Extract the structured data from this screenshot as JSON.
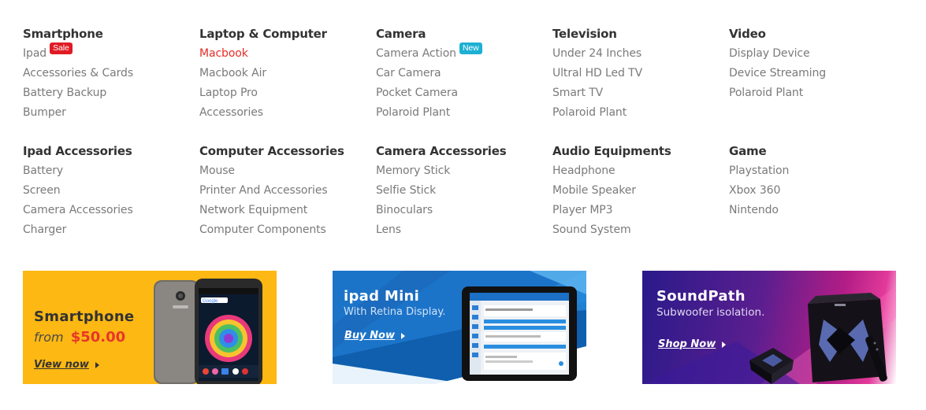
{
  "menu": {
    "row1": [
      {
        "title": "Smartphone",
        "items": [
          {
            "label": "Ipad",
            "badge": "Sale"
          },
          {
            "label": "Accessories & Cards"
          },
          {
            "label": "Battery Backup"
          },
          {
            "label": "Bumper"
          }
        ]
      },
      {
        "title": "Laptop & Computer",
        "items": [
          {
            "label": "Macbook",
            "active": true
          },
          {
            "label": "Macbook Air"
          },
          {
            "label": "Laptop Pro"
          },
          {
            "label": "Accessories"
          }
        ]
      },
      {
        "title": "Camera",
        "items": [
          {
            "label": "Camera Action",
            "badge": "New"
          },
          {
            "label": "Car Camera"
          },
          {
            "label": "Pocket Camera"
          },
          {
            "label": "Polaroid Plant"
          }
        ]
      },
      {
        "title": "Television",
        "items": [
          {
            "label": "Under 24 Inches"
          },
          {
            "label": "Ultral HD Led TV"
          },
          {
            "label": "Smart TV"
          },
          {
            "label": "Polaroid Plant"
          }
        ]
      },
      {
        "title": "Video",
        "items": [
          {
            "label": "Display Device"
          },
          {
            "label": "Device Streaming"
          },
          {
            "label": "Polaroid Plant"
          }
        ]
      }
    ],
    "row2": [
      {
        "title": "Ipad Accessories",
        "items": [
          {
            "label": "Battery"
          },
          {
            "label": "Screen"
          },
          {
            "label": "Camera Accessories"
          },
          {
            "label": "Charger"
          }
        ]
      },
      {
        "title": "Computer Accessories",
        "items": [
          {
            "label": "Mouse"
          },
          {
            "label": "Printer And Accessories"
          },
          {
            "label": "Network Equipment"
          },
          {
            "label": "Computer Components"
          }
        ]
      },
      {
        "title": "Camera Accessories",
        "items": [
          {
            "label": "Memory Stick"
          },
          {
            "label": "Selfie Stick"
          },
          {
            "label": "Binoculars"
          },
          {
            "label": "Lens"
          }
        ]
      },
      {
        "title": "Audio Equipments",
        "items": [
          {
            "label": "Headphone"
          },
          {
            "label": "Mobile Speaker"
          },
          {
            "label": "Player MP3"
          },
          {
            "label": "Sound System"
          }
        ]
      },
      {
        "title": "Game",
        "items": [
          {
            "label": "Playstation"
          },
          {
            "label": "Xbox 360"
          },
          {
            "label": "Nintendo"
          }
        ]
      }
    ]
  },
  "banners": {
    "smartphone": {
      "title": "Smartphone",
      "from": "from",
      "price": "$50.00",
      "cta": "View now",
      "phone_brand_text": "Google"
    },
    "ipad": {
      "title": "ipad Mini",
      "subtitle": "With Retina Display.",
      "cta": "Buy Now"
    },
    "soundpath": {
      "title": "SoundPath",
      "subtitle": "Subwoofer isolation.",
      "cta": "Shop Now"
    }
  },
  "colors": {
    "accent_red": "#e52d27",
    "sale_badge": "#e01b24",
    "new_badge": "#1eb0d4",
    "banner_yellow": "#fdb813",
    "banner_blue": "#1c74c9",
    "banner_purple": "#5a1e8f"
  }
}
